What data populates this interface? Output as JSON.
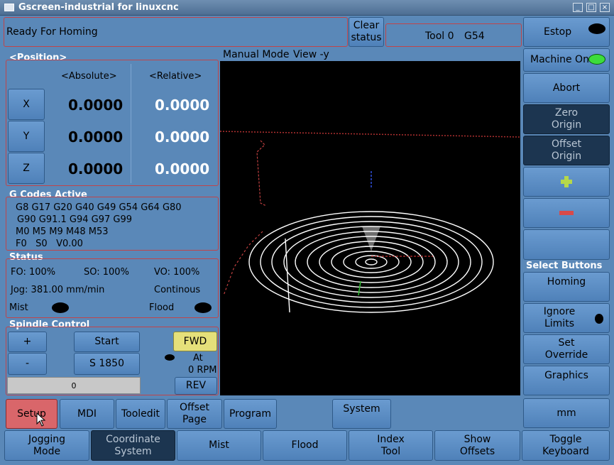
{
  "window": {
    "title": "Gscreen-industrial for linuxcnc",
    "buttons": [
      "_",
      "□",
      "×"
    ]
  },
  "status_bar": {
    "message": "Ready For Homing",
    "clear_status": "Clear\nstatus",
    "tool": "Tool 0",
    "coord_system": "G54"
  },
  "position": {
    "title": "<Position>",
    "absolute_header": "<Absolute>",
    "relative_header": "<Relative>",
    "axes": [
      {
        "name": "X",
        "absolute": "0.0000",
        "relative": "0.0000"
      },
      {
        "name": "Y",
        "absolute": "0.0000",
        "relative": "0.0000"
      },
      {
        "name": "Z",
        "absolute": "0.0000",
        "relative": "0.0000"
      }
    ]
  },
  "gcodes": {
    "title": "G Codes Active",
    "lines": [
      "G8 G17 G20 G40 G49 G54 G64 G80",
      "G90 G91.1 G94 G97 G99",
      "M0 M5 M9 M48 M53",
      "F0   S0   V0.00"
    ]
  },
  "status": {
    "title": "Status",
    "fo": "FO: 100%",
    "so": "SO: 100%",
    "vo": "VO: 100%",
    "jog": "Jog: 381.00 mm/min",
    "jog_mode": "Continous",
    "mist": "Mist",
    "flood": "Flood"
  },
  "spindle": {
    "title": "Spindle Control",
    "plus": "+",
    "minus": "-",
    "start": "Start",
    "speed_button": "S 1850",
    "fwd": "FWD",
    "at": "At",
    "rpm": "0 RPM",
    "rev": "REV",
    "override_value": "0"
  },
  "view": {
    "mode": "Manual Mode",
    "view": "View -y"
  },
  "right_panel": {
    "estop": "Estop",
    "machine_on": "Machine On",
    "abort": "Abort",
    "zero_origin": "Zero\nOrigin",
    "offset_origin": "Offset\nOrigin",
    "select_buttons_title": "Select Buttons",
    "homing": "Homing",
    "ignore_limits": "Ignore\nLimits",
    "set_override": "Set\nOverride",
    "graphics": "Graphics",
    "units": "mm"
  },
  "tabs_row1": {
    "setup": "Setup",
    "mdi": "MDI",
    "tooledit": "Tooledit",
    "offset_page": "Offset\nPage",
    "program": "Program",
    "system": "System"
  },
  "tabs_row2": {
    "jogging_mode": "Jogging\nMode",
    "coordinate_system": "Coordinate\nSystem",
    "mist": "Mist",
    "flood": "Flood",
    "index_tool": "Index\nTool",
    "show_offsets": "Show\nOffsets",
    "toggle_keyboard": "Toggle\nKeyboard"
  },
  "colors": {
    "background": "#5a88b8",
    "accent_red": "#c0444a",
    "active_yellow": "#e5e07a",
    "setup_red": "#d9666a"
  }
}
